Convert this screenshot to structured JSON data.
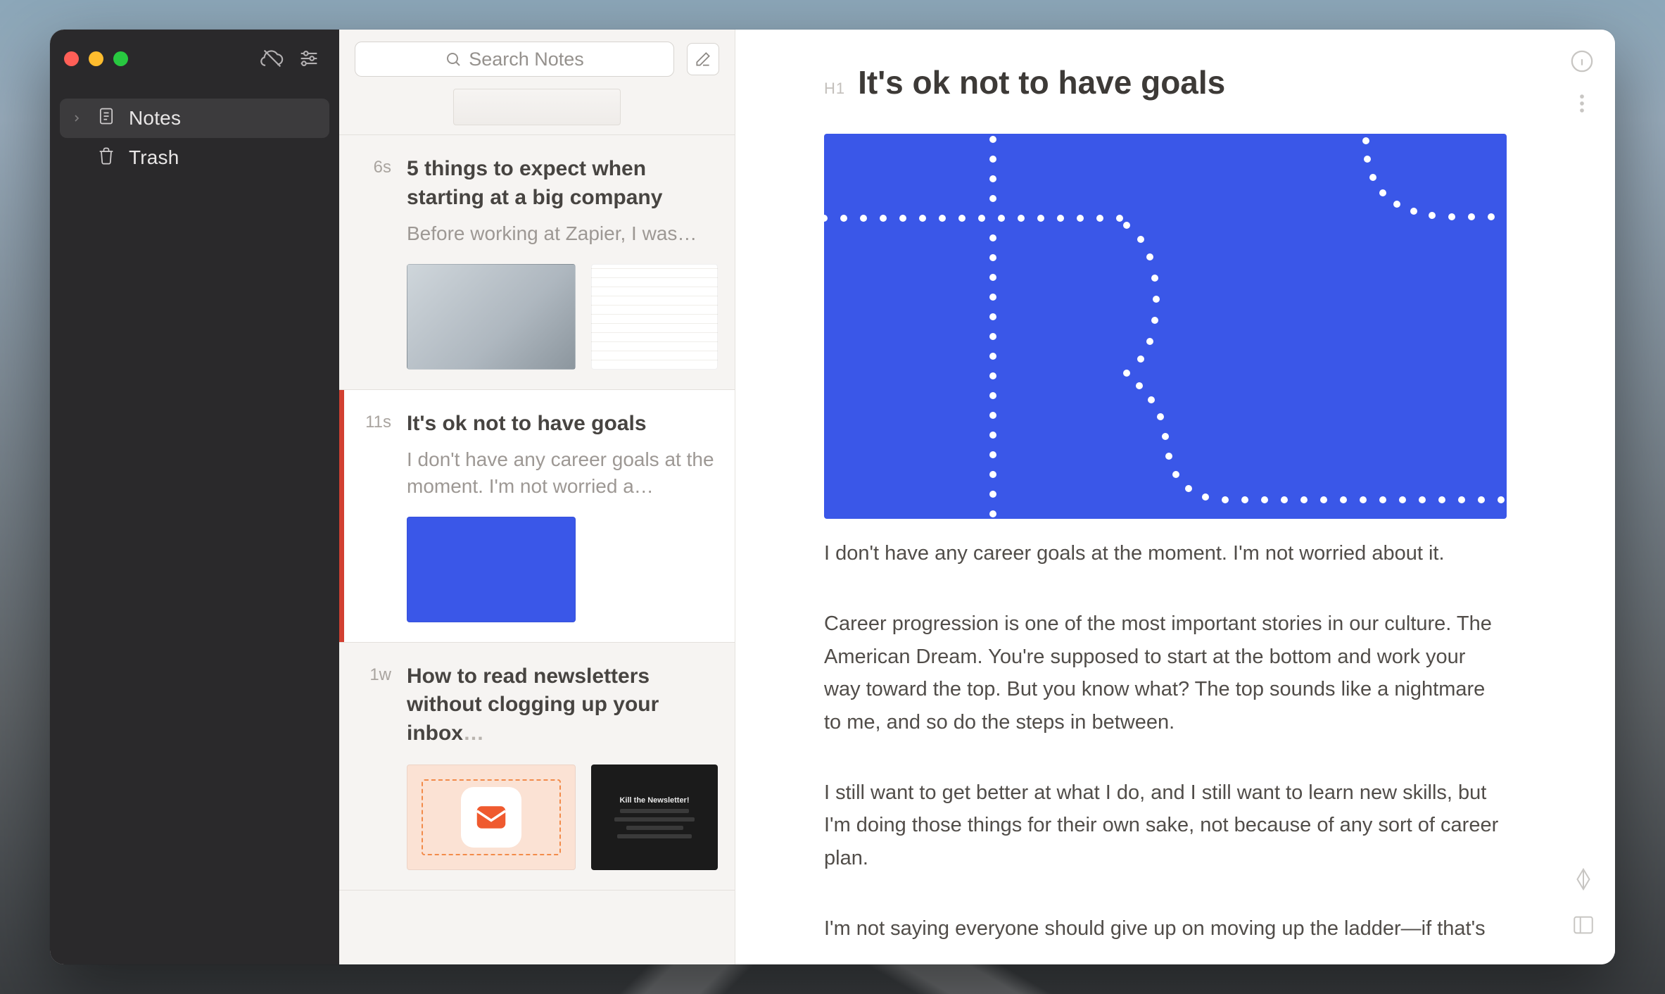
{
  "sidebar": {
    "items": [
      {
        "label": "Notes"
      },
      {
        "label": "Trash"
      }
    ]
  },
  "toolbar": {
    "search_placeholder": "Search Notes"
  },
  "notes": [
    {
      "age": "6s",
      "title": "5 things to expect when starting at a big company",
      "excerpt": "Before working at Zapier, I was…"
    },
    {
      "age": "11s",
      "title": "It's ok not to have goals",
      "excerpt": "I don't have any career goals at the moment. I'm not worried a…"
    },
    {
      "age": "1w",
      "title": "How to read newsletters without clogging up your inbox",
      "excerpt": "…"
    }
  ],
  "editor": {
    "h1_tag": "H1",
    "title": "It's ok not to have goals",
    "p1": "I don't have any career goals at the moment. I'm not worried about it.",
    "p2": "Career progression is one of the most important stories in our culture. The American Dream. You're supposed to start at the bottom and work your way toward the top. But you know what? The top sounds like a nightmare to me, and so do the steps in between.",
    "p3": "I still want to get better at what I do, and I still want to learn new skills, but I'm doing those things for their own sake, not because of any sort of career plan.",
    "p4": "I'm not saying everyone should give up on moving up the ladder—if that's"
  },
  "thumb_dark": {
    "headline": "Kill the Newsletter!"
  }
}
